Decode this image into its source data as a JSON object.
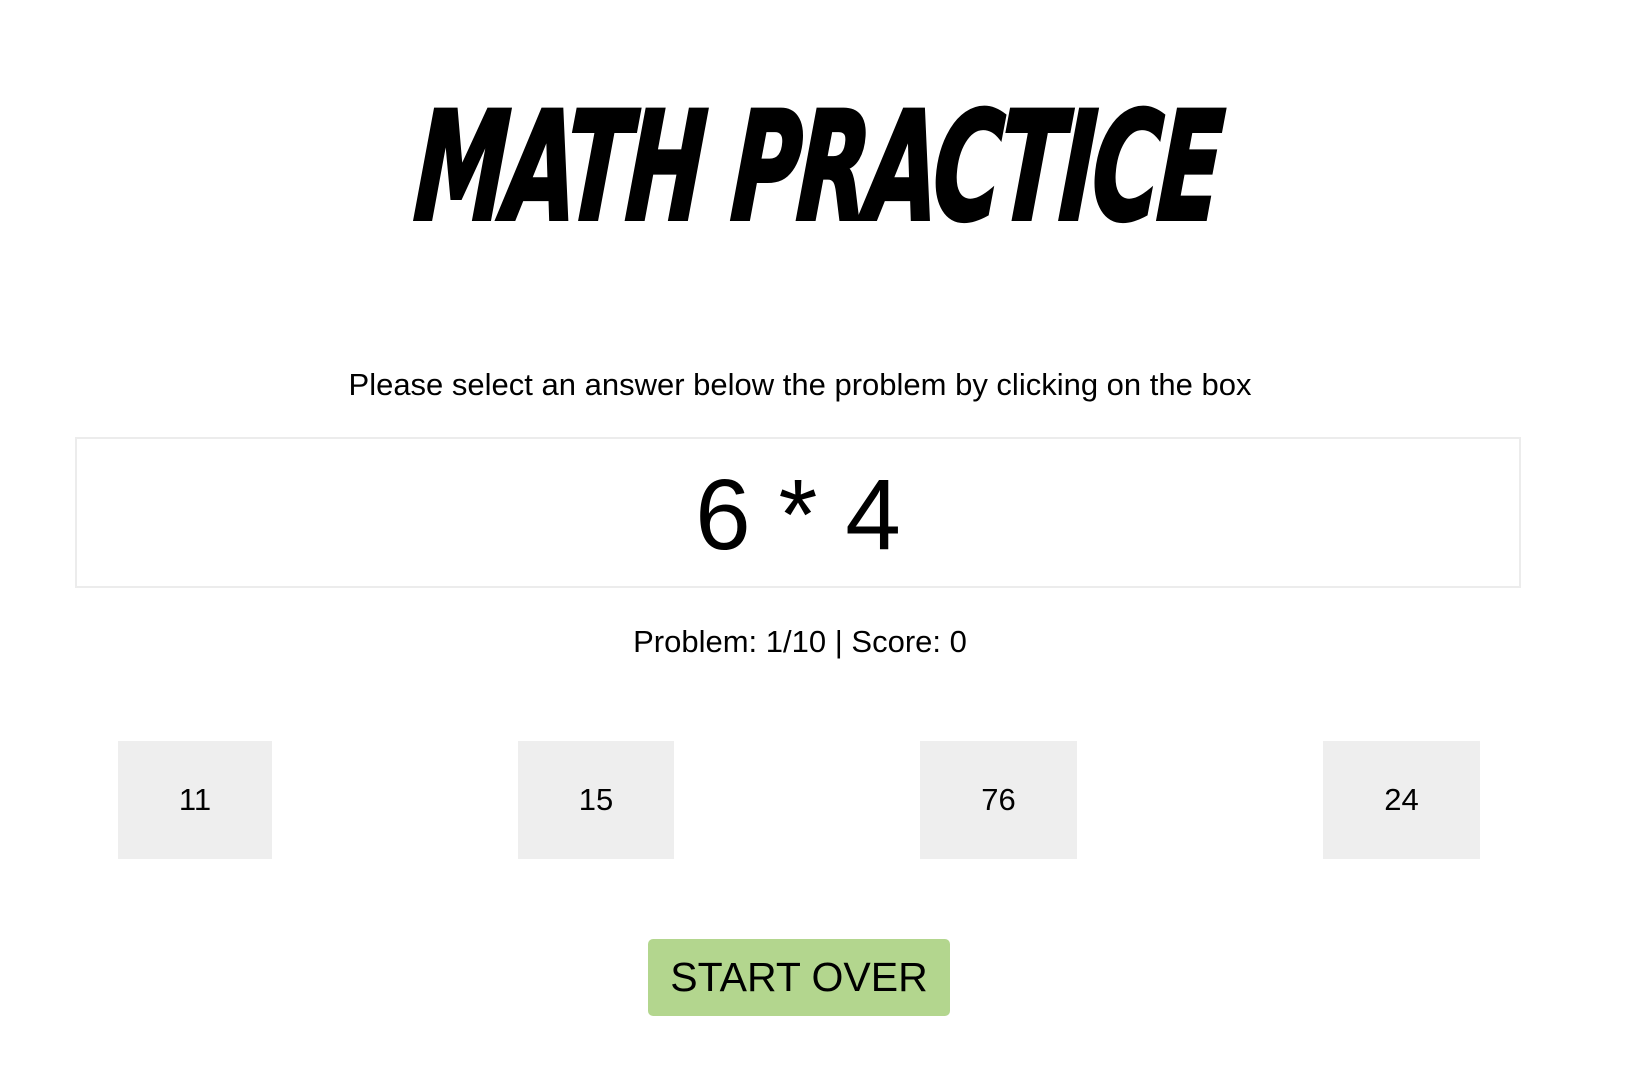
{
  "header": {
    "title": "MATH PRACTICE"
  },
  "instruction": "Please select an answer below the problem by clicking on the box",
  "problem": {
    "expression": "6 * 4"
  },
  "status": {
    "text": "Problem: 1/10 | Score: 0"
  },
  "answers": [
    {
      "label": "11"
    },
    {
      "label": "15"
    },
    {
      "label": "76"
    },
    {
      "label": "24"
    }
  ],
  "controls": {
    "start_over_label": "START OVER"
  },
  "colors": {
    "answer_box_bg": "#eeeeee",
    "start_over_bg": "#b3d68e",
    "problem_border": "#ececec"
  }
}
